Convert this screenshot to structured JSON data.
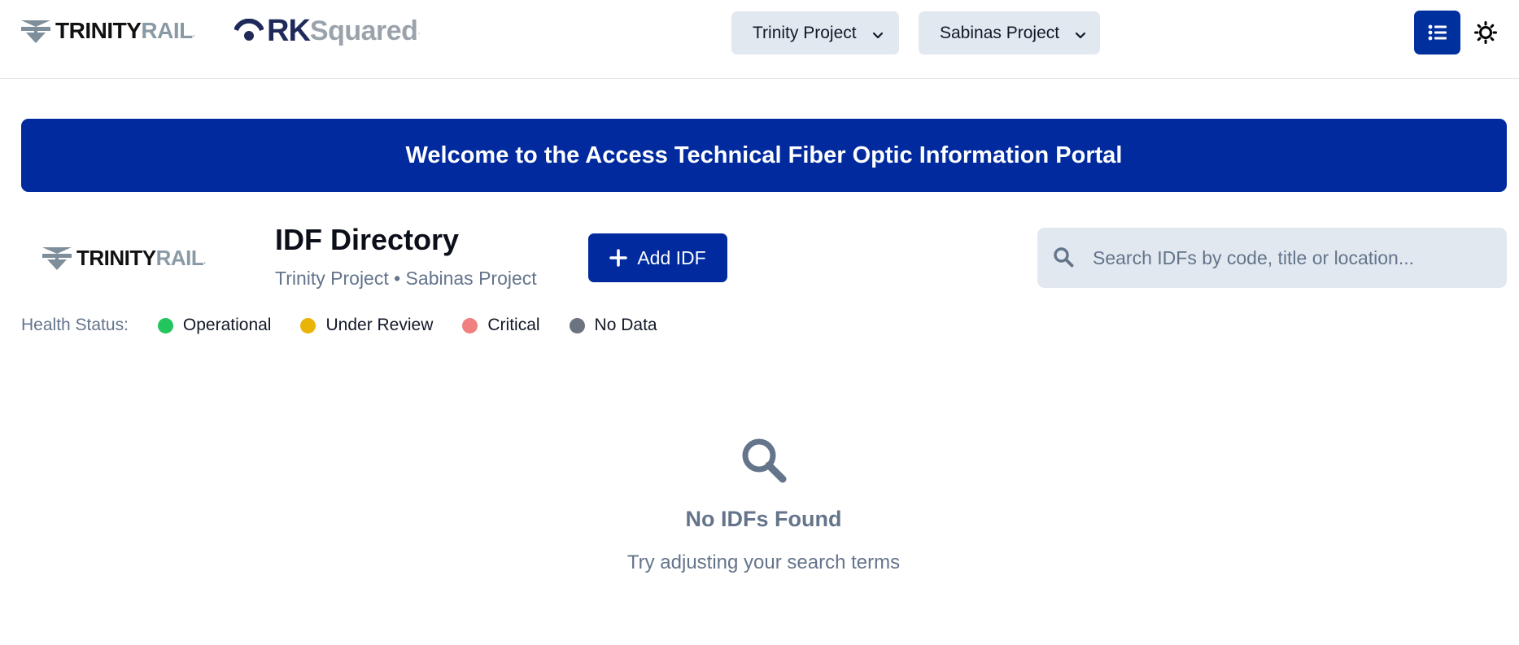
{
  "header": {
    "logo_trinity": {
      "part1": "TRINITY",
      "part2": "RAIL",
      "mark": "."
    },
    "logo_rk": {
      "part1": "RK",
      "part2": "Squared",
      "mark": "."
    },
    "project_selects": [
      {
        "value": "Trinity Project",
        "icon": "chevron-down-icon"
      },
      {
        "value": "Sabinas Project",
        "icon": "chevron-down-icon"
      }
    ],
    "list_view_icon": "list-icon",
    "theme_icon": "sun-icon",
    "colors": {
      "primary": "#002a9e",
      "select_bg": "#e2e8f0"
    }
  },
  "banner": {
    "title": "Welcome to the Access Technical Fiber Optic Information Portal"
  },
  "directory": {
    "logo": {
      "part1": "TRINITY",
      "part2": "RAIL",
      "mark": "."
    },
    "title": "IDF Directory",
    "subtitle": "Trinity Project • Sabinas Project",
    "add_button": "Add IDF",
    "search_placeholder": "Search IDFs by code, title or location..."
  },
  "health": {
    "label": "Health Status:",
    "items": [
      {
        "label": "Operational",
        "color": "#22c55e"
      },
      {
        "label": "Under Review",
        "color": "#eab308"
      },
      {
        "label": "Critical",
        "color": "#f08080"
      },
      {
        "label": "No Data",
        "color": "#6b7280"
      }
    ]
  },
  "empty_state": {
    "icon": "search-icon",
    "title": "No IDFs Found",
    "subtitle": "Try adjusting your search terms"
  }
}
